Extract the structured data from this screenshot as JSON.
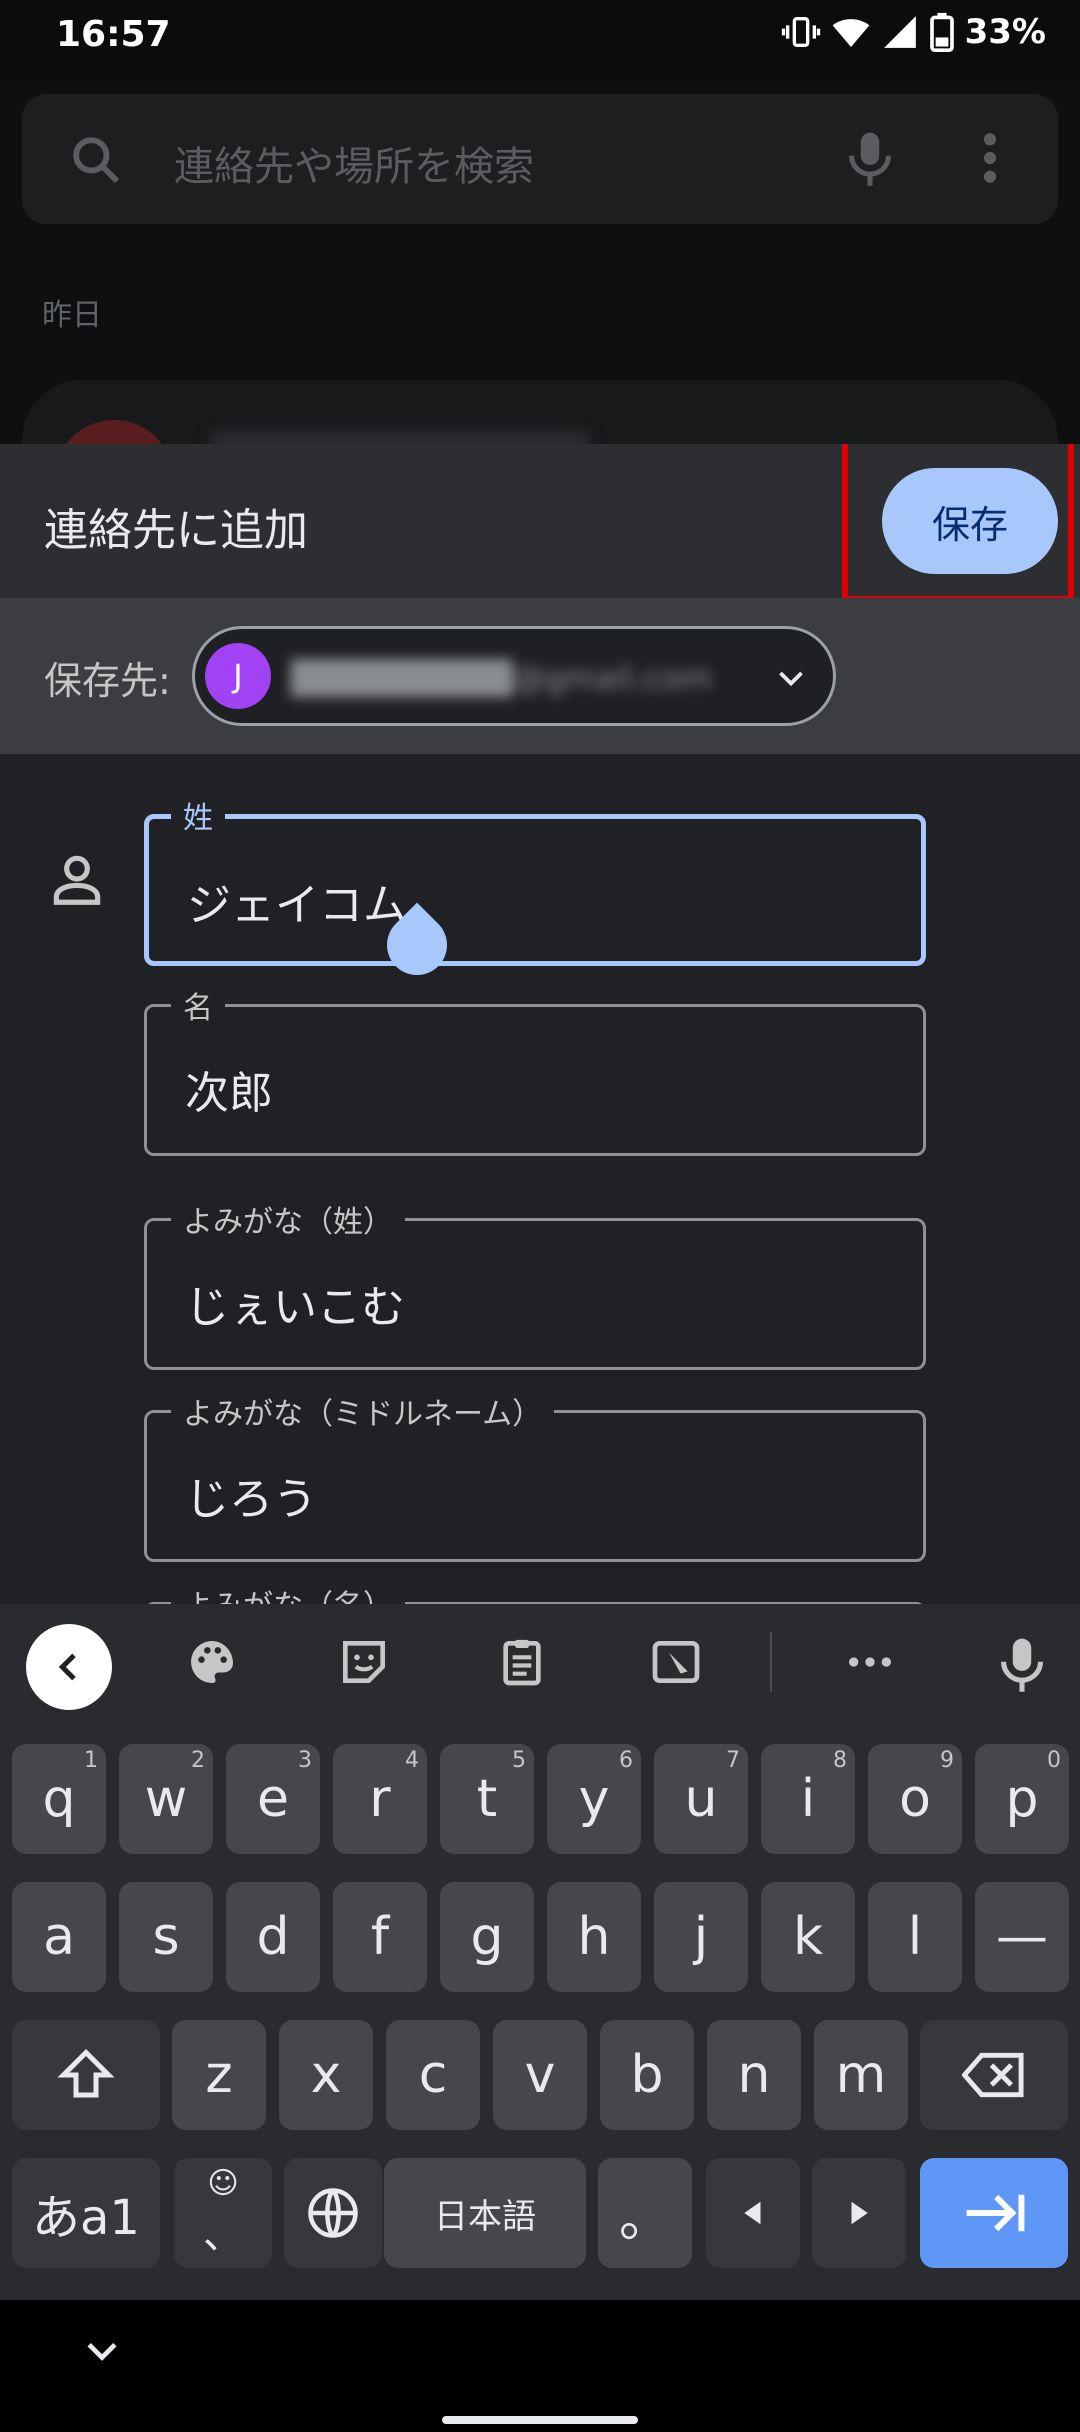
{
  "status_bar": {
    "time": "16:57",
    "battery": "33%"
  },
  "background": {
    "search_placeholder": "連絡先や場所を検索",
    "section_label": "昨日"
  },
  "dialog": {
    "title": "連絡先に追加",
    "save_label": "保存",
    "account_label": "保存先:",
    "account_avatar_letter": "J",
    "account_email": "█████████@gmail.com",
    "fields": [
      {
        "label": "姓",
        "value": "ジェイコム"
      },
      {
        "label": "名",
        "value": "次郎"
      },
      {
        "label": "よみがな（姓）",
        "value": "じぇいこむ"
      },
      {
        "label": "よみがな（ミドルネーム）",
        "value": "じろう"
      },
      {
        "label": "よみがな（名）",
        "value": ""
      }
    ]
  },
  "keyboard": {
    "row1": [
      "q",
      "w",
      "e",
      "r",
      "t",
      "y",
      "u",
      "i",
      "o",
      "p"
    ],
    "row1_numbers": [
      "1",
      "2",
      "3",
      "4",
      "5",
      "6",
      "7",
      "8",
      "9",
      "0"
    ],
    "row2": [
      "a",
      "s",
      "d",
      "f",
      "g",
      "h",
      "j",
      "k",
      "l",
      "—"
    ],
    "row3": [
      "z",
      "x",
      "c",
      "v",
      "b",
      "n",
      "m"
    ],
    "mode_key": "あa1",
    "space_label": "日本語",
    "period_key": "。",
    "comma_key": "、",
    "emoji_key": "☺",
    "accent_color": "#5e97f6"
  },
  "colors": {
    "save_button": "#a8c7fa",
    "highlight_box": "#e00000",
    "focused_field": "#a8c7fa"
  }
}
